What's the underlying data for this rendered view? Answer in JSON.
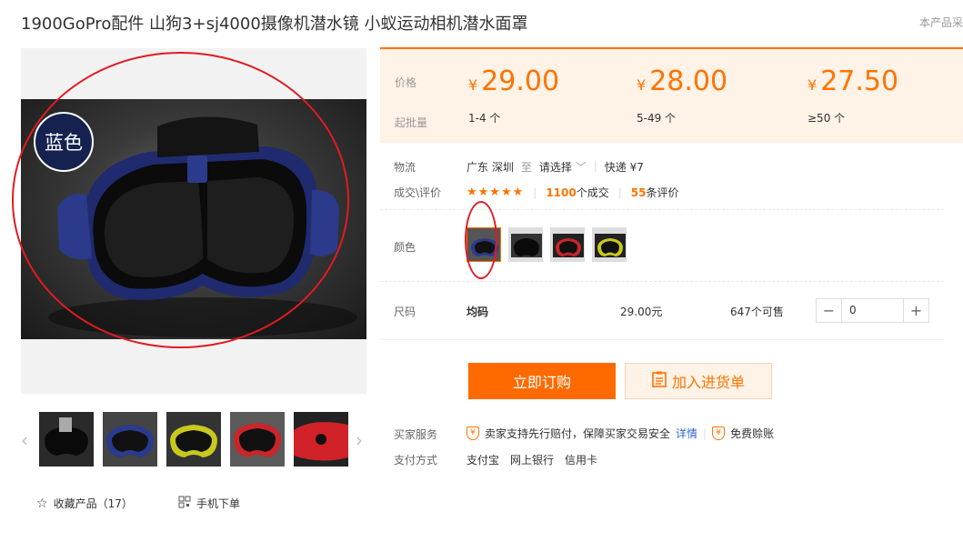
{
  "header": {
    "title": "1900GoPro配件 山狗3+sj4000摄像机潜水镜 小蚁运动相机潜水面罩",
    "report": "本产品采"
  },
  "gallery": {
    "main_badge": "蓝色",
    "thumb_count": 5
  },
  "actions": {
    "favorite": "收藏产品（17）",
    "mobile_order": "手机下单"
  },
  "price": {
    "price_label": "价格",
    "batch_label": "起批量",
    "currency": "¥",
    "tiers": [
      {
        "price": "29.00",
        "range": "1-4 个"
      },
      {
        "price": "28.00",
        "range": "5-49 个"
      },
      {
        "price": "27.50",
        "range": "≥50 个"
      }
    ]
  },
  "logistics": {
    "label": "物流",
    "from": "广东 深圳",
    "to_word": "至",
    "select": "请选择",
    "express": "快递 ¥7"
  },
  "rating": {
    "label": "成交\\评价",
    "stars": "★★★★★",
    "deals_num": "1100",
    "deals_text": "个成交",
    "reviews_num": "55",
    "reviews_text": "条评价"
  },
  "color": {
    "label": "颜色",
    "options": [
      "蓝色",
      "黑色",
      "红色",
      "黄色"
    ],
    "selected": "蓝色"
  },
  "size": {
    "label": "尺码",
    "name": "均码",
    "price": "29.00元",
    "stock": "647个可售",
    "quantity": "0",
    "minus": "−",
    "plus": "+"
  },
  "buttons": {
    "buy": "立即订购",
    "cart": "加入进货单"
  },
  "service": {
    "label": "买家服务",
    "guarantee": "卖家支持先行赔付，保障买家交易安全",
    "details": "详情",
    "free_claim": "免费赊账"
  },
  "payment": {
    "label": "支付方式",
    "methods": [
      "支付宝",
      "网上银行",
      "信用卡"
    ]
  },
  "colors": {
    "accent": "#ff7300",
    "highlight_red": "#e01b22",
    "mask_blue": "#2b3a8a"
  }
}
